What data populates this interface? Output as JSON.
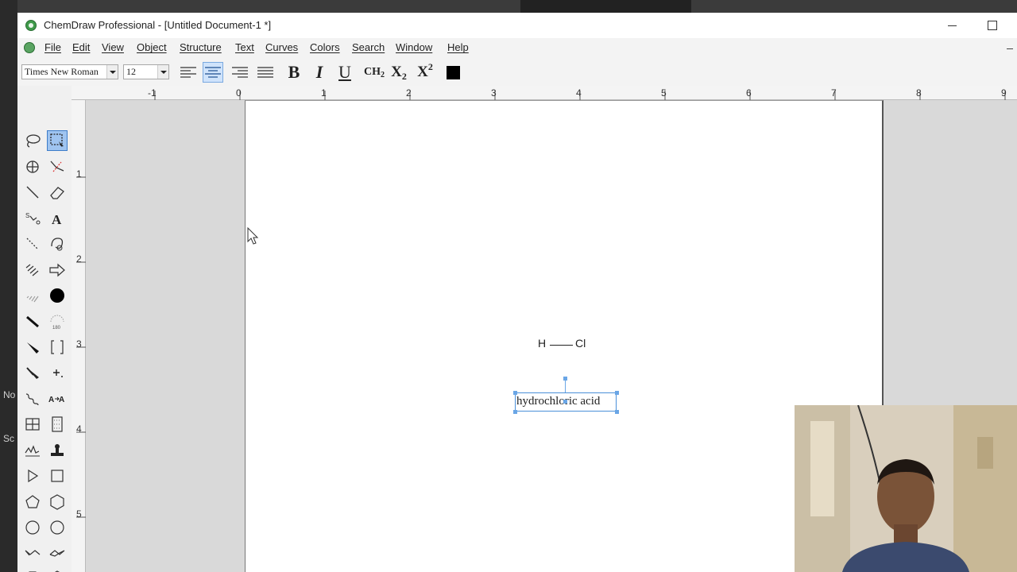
{
  "window": {
    "title": "ChemDraw Professional - [Untitled Document-1 *]"
  },
  "desktop": {
    "side_texts": [
      "No",
      "Sc"
    ]
  },
  "menu": {
    "items": [
      {
        "label": "File"
      },
      {
        "label": "Edit"
      },
      {
        "label": "View"
      },
      {
        "label": "Object"
      },
      {
        "label": "Structure"
      },
      {
        "label": "Text"
      },
      {
        "label": "Curves"
      },
      {
        "label": "Colors"
      },
      {
        "label": "Search"
      },
      {
        "label": "Window"
      },
      {
        "label": "Help"
      }
    ]
  },
  "toolbar": {
    "font_name": "Times New Roman",
    "font_size": "12",
    "bold_label": "B",
    "italic_label": "I",
    "underline_label": "U",
    "formula_label": "CH",
    "formula_sub": "2",
    "subscript_label": "X",
    "subscript_sub": "2",
    "superscript_label": "X",
    "superscript_sup": "2",
    "active_alignment": "center",
    "text_color": "#000000"
  },
  "ruler": {
    "horizontal": [
      "-1",
      "0",
      "1",
      "2",
      "3",
      "4",
      "5",
      "6",
      "7",
      "8",
      "9"
    ],
    "vertical": [
      "1",
      "2",
      "3",
      "4",
      "5"
    ]
  },
  "document": {
    "molecule": {
      "atom1": "H",
      "atom2": "Cl"
    },
    "caption": "hydrochloric acid"
  },
  "colors": {
    "selection": "#4a90d9",
    "active_tool": "#9fc4f0"
  }
}
